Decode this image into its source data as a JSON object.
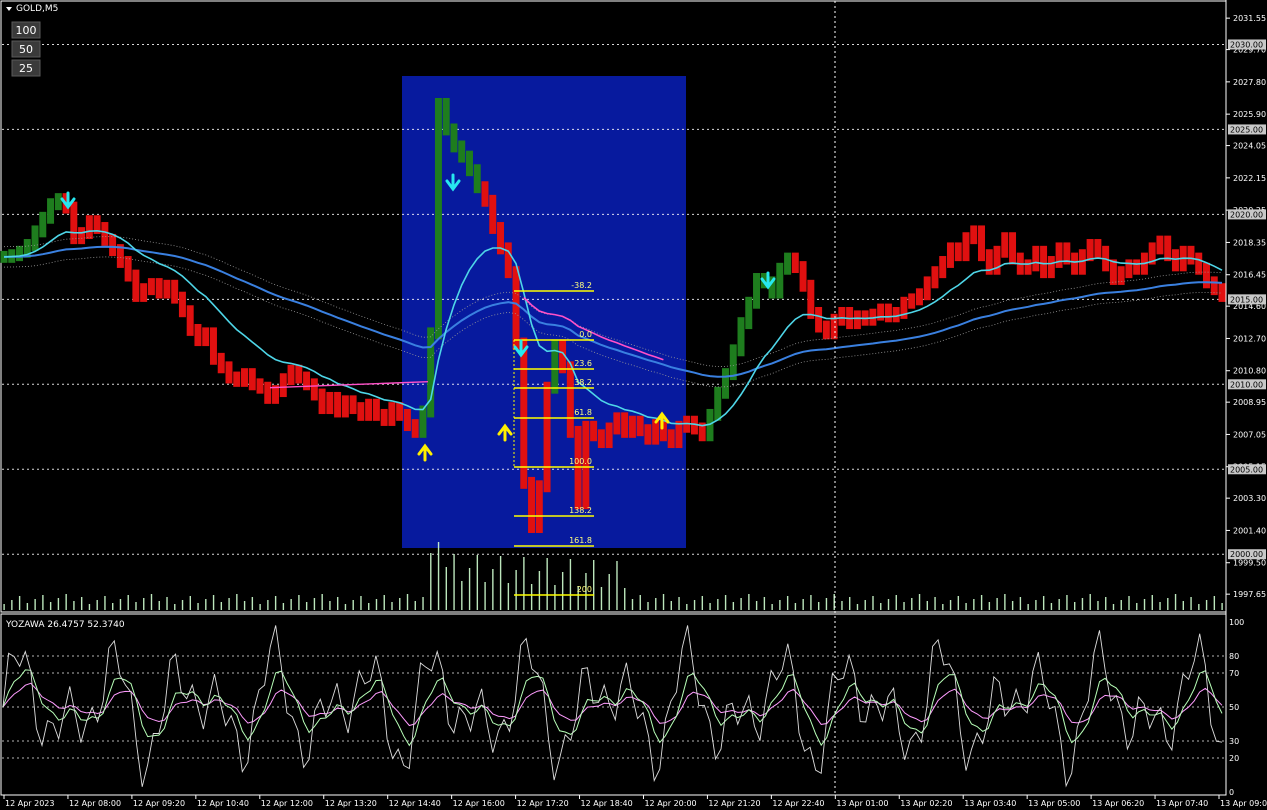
{
  "symbol": {
    "label": "GOLD,M5"
  },
  "zoom_buttons": [
    {
      "label": "100",
      "color": "#c0c0c0"
    },
    {
      "label": "50",
      "color": "#c0c0c0"
    },
    {
      "label": "25",
      "color": "#ff2020"
    }
  ],
  "colors": {
    "background": "#000000",
    "bull_bar": "#1e7d1e",
    "bear_bar": "#e01010",
    "ma_fast": "#4ed6e8",
    "ma_slow": "#3a80e0",
    "ma_mid": "#ff50c8",
    "highlight_box": "#071a9e",
    "fib": "#ffff00",
    "volume": "#d0ffd0",
    "arrow_up": "#ffee00",
    "arrow_down": "#27e7ef",
    "osc_main": "#dddddd",
    "osc_signal_1": "#b7ffb7",
    "osc_signal_2": "#ff9cff"
  },
  "price_axis": {
    "ticks": [
      "2031.55",
      "2029.70",
      "2027.80",
      "2025.90",
      "2024.05",
      "2022.15",
      "2020.25",
      "2018.35",
      "2016.45",
      "2014.60",
      "2012.70",
      "2010.80",
      "2008.95",
      "2007.05",
      "2005.15",
      "2003.30",
      "2001.40",
      "1999.50",
      "1997.65"
    ],
    "level_labels": [
      "2030.00",
      "2025.00",
      "2020.00",
      "2015.00",
      "2010.00",
      "2005.00",
      "2000.00"
    ]
  },
  "time_axis": {
    "ticks": [
      "12 Apr 2023",
      "12 Apr 08:00",
      "12 Apr 09:20",
      "12 Apr 10:40",
      "12 Apr 12:00",
      "12 Apr 13:20",
      "12 Apr 14:40",
      "12 Apr 16:00",
      "12 Apr 17:20",
      "12 Apr 18:40",
      "12 Apr 20:00",
      "12 Apr 21:20",
      "12 Apr 22:40",
      "13 Apr 01:00",
      "13 Apr 02:20",
      "13 Apr 03:40",
      "13 Apr 05:00",
      "13 Apr 06:20",
      "13 Apr 07:40",
      "13 Apr 09:00"
    ]
  },
  "fib": {
    "levels": [
      "-38.2",
      "0.0",
      "23.6",
      "38.2",
      "61.8",
      "100.0",
      "138.2",
      "161.8",
      "200"
    ]
  },
  "oscillator": {
    "header": "YOZAWA 26.4757 52.3740",
    "ticks": [
      "100",
      "80",
      "70",
      "50",
      "30",
      "20",
      "0"
    ]
  },
  "chart_data": {
    "type": "candlestick",
    "title": "GOLD,M5",
    "ylim": [
      1996.6,
      2032.5
    ],
    "price_series": [
      [
        2017.5,
        "g"
      ],
      [
        2017.6,
        "g"
      ],
      [
        2017.8,
        "g"
      ],
      [
        2018.2,
        "g"
      ],
      [
        2019.0,
        "g"
      ],
      [
        2019.8,
        "g"
      ],
      [
        2020.6,
        "g"
      ],
      [
        2020.9,
        "g"
      ],
      [
        2020.4,
        "r"
      ],
      [
        2018.6,
        "r"
      ],
      [
        2018.9,
        "r"
      ],
      [
        2019.6,
        "r"
      ],
      [
        2019.2,
        "r"
      ],
      [
        2018.5,
        "r"
      ],
      [
        2017.9,
        "r"
      ],
      [
        2017.2,
        "r"
      ],
      [
        2016.4,
        "r"
      ],
      [
        2015.2,
        "r"
      ],
      [
        2015.6,
        "r"
      ],
      [
        2015.9,
        "r"
      ],
      [
        2015.4,
        "r"
      ],
      [
        2015.8,
        "r"
      ],
      [
        2015.1,
        "r"
      ],
      [
        2014.3,
        "r"
      ],
      [
        2013.2,
        "r"
      ],
      [
        2012.6,
        "r"
      ],
      [
        2013.0,
        "r"
      ],
      [
        2011.5,
        "r"
      ],
      [
        2011.0,
        "r"
      ],
      [
        2010.4,
        "r"
      ],
      [
        2010.2,
        "r"
      ],
      [
        2010.6,
        "r"
      ],
      [
        2010.0,
        "r"
      ],
      [
        2009.8,
        "r"
      ],
      [
        2009.2,
        "r"
      ],
      [
        2009.6,
        "r"
      ],
      [
        2010.3,
        "r"
      ],
      [
        2010.8,
        "r"
      ],
      [
        2010.4,
        "r"
      ],
      [
        2010.0,
        "r"
      ],
      [
        2009.4,
        "r"
      ],
      [
        2008.6,
        "r"
      ],
      [
        2009.2,
        "r"
      ],
      [
        2008.4,
        "r"
      ],
      [
        2009.0,
        "r"
      ],
      [
        2008.6,
        "r"
      ],
      [
        2008.2,
        "r"
      ],
      [
        2008.8,
        "r"
      ],
      [
        2008.2,
        "r"
      ],
      [
        2007.9,
        "r"
      ],
      [
        2008.6,
        "r"
      ],
      [
        2008.2,
        "r"
      ],
      [
        2007.6,
        "r"
      ],
      [
        2007.2,
        "r"
      ],
      [
        2008.4,
        "g"
      ],
      [
        2013.0,
        "g"
      ],
      [
        2026.5,
        "g"
      ],
      [
        2025.0,
        "g"
      ],
      [
        2024.0,
        "g"
      ],
      [
        2023.4,
        "g"
      ],
      [
        2022.6,
        "g"
      ],
      [
        2021.6,
        "g"
      ],
      [
        2020.8,
        "r"
      ],
      [
        2019.2,
        "r"
      ],
      [
        2018.0,
        "r"
      ],
      [
        2016.6,
        "r"
      ],
      [
        2012.4,
        "r"
      ],
      [
        2004.2,
        "r"
      ],
      [
        2001.6,
        "r"
      ],
      [
        2004.0,
        "r"
      ],
      [
        2009.8,
        "r"
      ],
      [
        2012.3,
        "g"
      ],
      [
        2011.0,
        "r"
      ],
      [
        2007.2,
        "r"
      ],
      [
        2003.0,
        "r"
      ],
      [
        2007.5,
        "r"
      ],
      [
        2007.0,
        "r"
      ],
      [
        2006.6,
        "r"
      ],
      [
        2007.4,
        "r"
      ],
      [
        2008.0,
        "r"
      ],
      [
        2007.2,
        "r"
      ],
      [
        2007.8,
        "r"
      ],
      [
        2007.3,
        "r"
      ],
      [
        2006.8,
        "r"
      ],
      [
        2007.6,
        "r"
      ],
      [
        2007.0,
        "r"
      ],
      [
        2006.6,
        "r"
      ],
      [
        2007.5,
        "r"
      ],
      [
        2007.8,
        "r"
      ],
      [
        2007.4,
        "r"
      ],
      [
        2007.0,
        "r"
      ],
      [
        2008.2,
        "g"
      ],
      [
        2009.5,
        "g"
      ],
      [
        2010.6,
        "g"
      ],
      [
        2012.0,
        "g"
      ],
      [
        2013.6,
        "g"
      ],
      [
        2014.8,
        "g"
      ],
      [
        2016.2,
        "g"
      ],
      [
        2016.0,
        "g"
      ],
      [
        2015.4,
        "g"
      ],
      [
        2016.8,
        "g"
      ],
      [
        2017.4,
        "g"
      ],
      [
        2016.9,
        "r"
      ],
      [
        2015.8,
        "r"
      ],
      [
        2014.2,
        "r"
      ],
      [
        2013.4,
        "r"
      ],
      [
        2013.0,
        "r"
      ],
      [
        2013.8,
        "r"
      ],
      [
        2014.2,
        "r"
      ],
      [
        2013.6,
        "r"
      ],
      [
        2014.0,
        "r"
      ],
      [
        2013.8,
        "r"
      ],
      [
        2014.1,
        "r"
      ],
      [
        2014.4,
        "r"
      ],
      [
        2014.0,
        "r"
      ],
      [
        2014.2,
        "r"
      ],
      [
        2014.8,
        "r"
      ],
      [
        2015.0,
        "r"
      ],
      [
        2015.3,
        "r"
      ],
      [
        2016.0,
        "r"
      ],
      [
        2016.6,
        "r"
      ],
      [
        2017.2,
        "r"
      ],
      [
        2018.0,
        "r"
      ],
      [
        2017.6,
        "r"
      ],
      [
        2018.6,
        "r"
      ],
      [
        2019.0,
        "r"
      ],
      [
        2017.6,
        "r"
      ],
      [
        2016.8,
        "r"
      ],
      [
        2017.8,
        "r"
      ],
      [
        2018.6,
        "r"
      ],
      [
        2017.4,
        "r"
      ],
      [
        2016.8,
        "r"
      ],
      [
        2017.0,
        "r"
      ],
      [
        2017.8,
        "r"
      ],
      [
        2016.6,
        "r"
      ],
      [
        2017.2,
        "r"
      ],
      [
        2018.0,
        "r"
      ],
      [
        2017.4,
        "r"
      ],
      [
        2016.8,
        "r"
      ],
      [
        2017.6,
        "r"
      ],
      [
        2018.2,
        "r"
      ],
      [
        2017.8,
        "r"
      ],
      [
        2017.0,
        "r"
      ],
      [
        2016.2,
        "r"
      ],
      [
        2016.6,
        "r"
      ],
      [
        2017.0,
        "r"
      ],
      [
        2016.8,
        "r"
      ],
      [
        2017.4,
        "r"
      ],
      [
        2018.0,
        "r"
      ],
      [
        2018.4,
        "r"
      ],
      [
        2017.6,
        "r"
      ],
      [
        2017.0,
        "r"
      ],
      [
        2017.8,
        "r"
      ],
      [
        2017.4,
        "r"
      ],
      [
        2016.8,
        "r"
      ],
      [
        2016.0,
        "r"
      ],
      [
        2015.6,
        "r"
      ],
      [
        2015.2,
        "r"
      ]
    ]
  }
}
